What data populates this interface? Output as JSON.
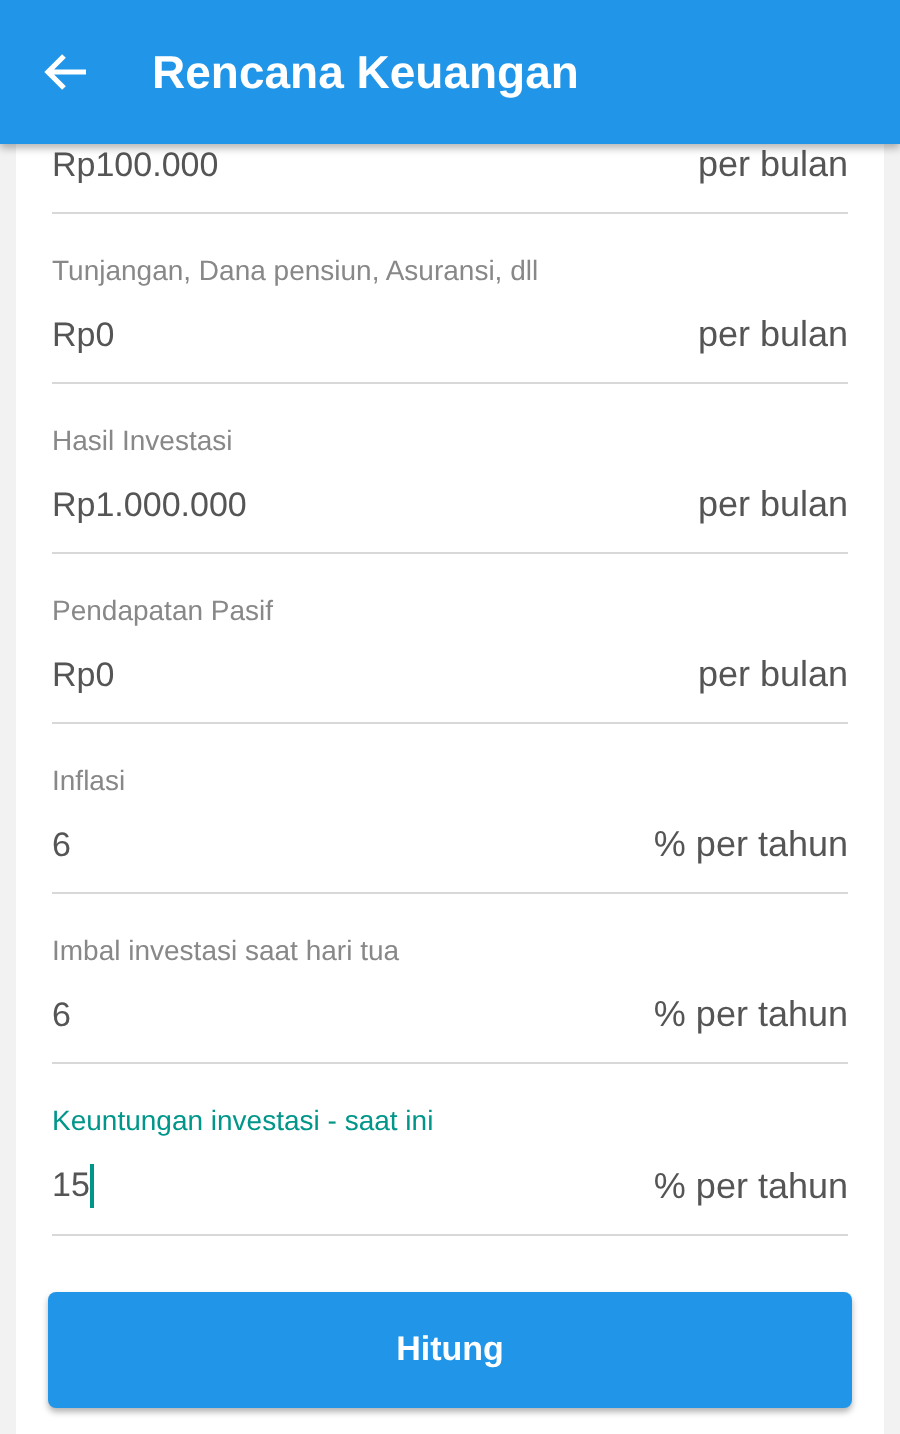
{
  "app_bar": {
    "title": "Rencana Keuangan"
  },
  "fields": [
    {
      "value": "Rp100.000",
      "unit": "per bulan",
      "focused": false
    },
    {
      "label": "Tunjangan, Dana pensiun, Asuransi, dll",
      "value": "Rp0",
      "unit": "per bulan",
      "focused": false
    },
    {
      "label": "Hasil Investasi",
      "value": "Rp1.000.000",
      "unit": "per bulan",
      "focused": false
    },
    {
      "label": "Pendapatan Pasif",
      "value": "Rp0",
      "unit": "per bulan",
      "focused": false
    },
    {
      "label": "Inflasi",
      "value": "6",
      "unit": "% per tahun",
      "focused": false
    },
    {
      "label": "Imbal investasi saat hari tua",
      "value": "6",
      "unit": "% per tahun",
      "focused": false
    },
    {
      "label": "Keuntungan investasi - saat ini",
      "value": "15",
      "unit": "% per tahun",
      "focused": true
    }
  ],
  "button": {
    "label": "Hitung"
  }
}
